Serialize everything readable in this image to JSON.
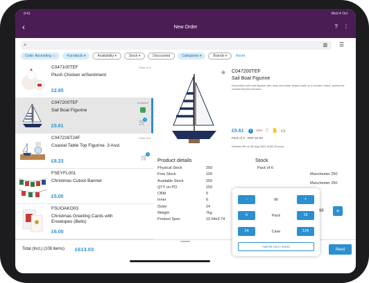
{
  "status": {
    "time": "9:41",
    "date": "Wed 4 Oct"
  },
  "header": {
    "title": "New Order"
  },
  "search": {
    "placeholder": ""
  },
  "chips": [
    {
      "label": "Code: Ascending ↑↓",
      "style": "blue"
    },
    {
      "label": "4 products ▾",
      "style": "blue"
    },
    {
      "label": "Availability ▾",
      "style": "outline"
    },
    {
      "label": "Stock ▾",
      "style": "outline"
    },
    {
      "label": "Discounted",
      "style": "outline"
    },
    {
      "label": "Categories ▾",
      "style": "blue"
    },
    {
      "label": "Brands ▾",
      "style": "outline"
    },
    {
      "label": "Reset",
      "style": "reset"
    }
  ],
  "products": [
    {
      "code": "C047100TEF",
      "name": "Plush Chicken w/Sentiment",
      "price": "£2.65",
      "pack": "Pack of 8",
      "selected": false,
      "badge": ""
    },
    {
      "code": "C047200TEF",
      "name": "Sail Boat Figurine",
      "price": "£5.61",
      "pack": "Available",
      "selected": true,
      "badge": "4"
    },
    {
      "code": "C047226T24F",
      "name": "Coastal Table Top Figurine. 3 Asst.",
      "price": "£8.23",
      "pack": "Pack of 6",
      "selected": false,
      "badge": "2"
    },
    {
      "code": "FSEYFL001",
      "name": "Christmas Cutout Banner",
      "price": "£5.00",
      "pack": "",
      "selected": false,
      "badge": ""
    },
    {
      "code": "FSUOAKO03",
      "name": "Christmas Greeting Cards with Envelopes (Bells)",
      "price": "£6.00",
      "pack": "",
      "selected": false,
      "badge": ""
    }
  ],
  "detail": {
    "code": "C047200TEF",
    "name": "Sail Boat Figurine",
    "description": "Decorative sail boat figurine with navy and white striped sails on a wooden stand, perfect for coastal themed interiors.",
    "price": "£5.61",
    "discount": "-10%",
    "pack": "Pack of 6 · RRP £9.99",
    "ordered": "Ordered 50 on 30 Aug 2022 at £5.23 more",
    "product_details_title": "Product details",
    "stock_title": "Stock",
    "specs": [
      {
        "k": "Physical Stock",
        "v": "250"
      },
      {
        "k": "Free Stock",
        "v": "100"
      },
      {
        "k": "Available Stock",
        "v": "250"
      },
      {
        "k": "QTY on PO",
        "v": "150"
      },
      {
        "k": "CBM",
        "v": "0"
      },
      {
        "k": "Inner",
        "v": "6"
      },
      {
        "k": "Outer",
        "v": "24"
      },
      {
        "k": "Weight",
        "v": "7kg"
      },
      {
        "k": "Product Spec",
        "v": "10.94x3.74"
      }
    ],
    "stock_pack": "Pack of 6",
    "stock_locations": [
      {
        "name": "Manchester",
        "qty": "250"
      },
      {
        "name": "Manchester",
        "qty": "250"
      }
    ]
  },
  "popup": {
    "minus": "−",
    "qty": "96",
    "plus": "+",
    "pack_minus": "6",
    "pack_label": "Pack",
    "pack_plus": "16",
    "case_minus": "24",
    "case_label": "Case",
    "case_plus": "124",
    "add_label": "Add 96 (16 in stock)",
    "side_qty": "96",
    "side_plus": "+"
  },
  "footer": {
    "total_label": "Total (Incl.) (108 items)",
    "total_value": "£613.03",
    "next_label": "Next"
  },
  "colors": {
    "header": "#4b1d55",
    "accent": "#2c8fcf"
  }
}
